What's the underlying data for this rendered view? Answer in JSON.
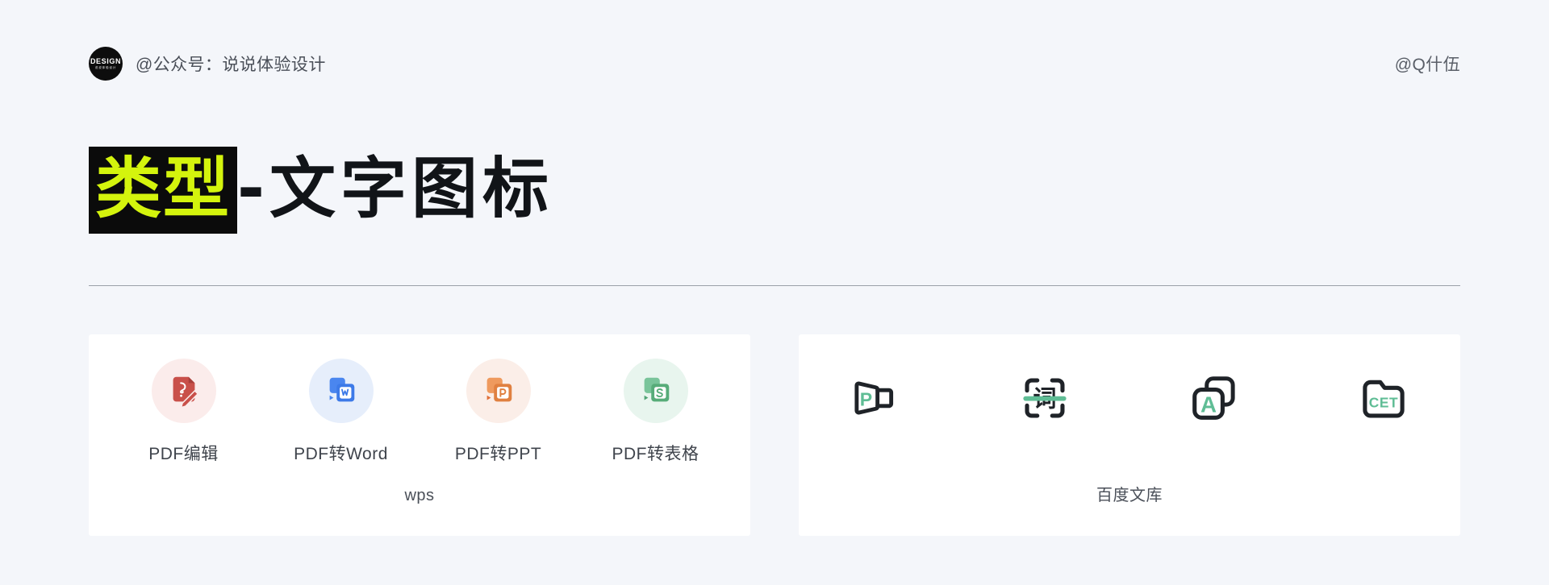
{
  "header": {
    "logo_text": "DESIGN",
    "logo_sub": "说说体验设计",
    "logo_icon": "design-circle-logo",
    "handle": "@公众号：说说体验设计",
    "author": "@Q什伍"
  },
  "title": {
    "highlight": "类型",
    "rest": "-文字图标",
    "highlight_bg": "#0b0b0b",
    "highlight_color": "#d4f40d",
    "rest_color": "#111418"
  },
  "divider": {
    "color": "#9aa0a8"
  },
  "colors": {
    "page_bg": "#f4f6fa",
    "card_bg": "#ffffff",
    "accent_green": "#5fbd95",
    "outline_dark": "#1f2328"
  },
  "cards": [
    {
      "name": "wps-card",
      "footer": "wps",
      "items": [
        {
          "label": "PDF编辑",
          "icon": "pdf-edit-icon",
          "circle_bg": "#fbeceb",
          "icon_color": "#c9504a"
        },
        {
          "label": "PDF转Word",
          "icon": "pdf-to-word-icon",
          "circle_bg": "#e6eefb",
          "icon_color": "#3d7ae8"
        },
        {
          "label": "PDF转PPT",
          "icon": "pdf-to-ppt-icon",
          "circle_bg": "#fbeee8",
          "icon_color": "#e08040"
        },
        {
          "label": "PDF转表格",
          "icon": "pdf-to-sheet-icon",
          "circle_bg": "#e8f5ee",
          "icon_color": "#57ac79"
        }
      ]
    },
    {
      "name": "baidu-wenku-card",
      "footer": "百度文库",
      "items": [
        {
          "label": "",
          "icon": "ppt-outline-icon",
          "glyph": "P",
          "icon_color": "#5fbd95"
        },
        {
          "label": "",
          "icon": "scan-translate-icon",
          "glyph": "词",
          "icon_color": "#5fbd95"
        },
        {
          "label": "",
          "icon": "stacked-cards-a-icon",
          "glyph": "A",
          "icon_color": "#5fbd95"
        },
        {
          "label": "",
          "icon": "cet-folder-icon",
          "glyph": "CET",
          "icon_color": "#5fbd95"
        }
      ]
    }
  ]
}
